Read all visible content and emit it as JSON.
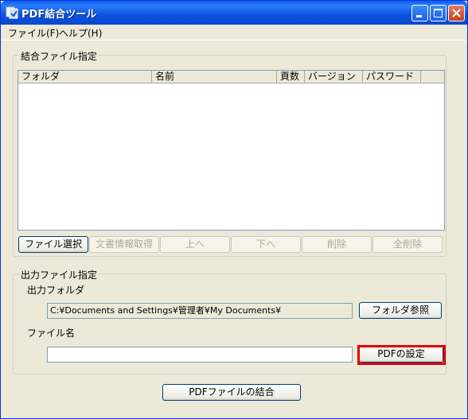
{
  "window": {
    "title": "PDF結合ツール",
    "icons": {
      "app": "pdf-app-icon",
      "minimize": "minimize-icon",
      "maximize": "maximize-icon",
      "close": "close-icon"
    }
  },
  "menu": {
    "items": [
      {
        "label": "ファイル(F)"
      },
      {
        "label": "ヘルプ(H)"
      }
    ]
  },
  "input_group": {
    "title": "結合ファイル指定",
    "columns": [
      "フォルダ",
      "名前",
      "頁数",
      "バージョン",
      "パスワード"
    ],
    "rows": [],
    "buttons": {
      "select_file": "ファイル選択",
      "get_doc_info": "文書情報取得",
      "move_up": "上へ",
      "move_down": "下へ",
      "delete": "削除",
      "delete_all": "全削除"
    }
  },
  "output_group": {
    "title": "出力ファイル指定",
    "folder_label": "出力フォルダ",
    "folder_value": "C:¥Documents and Settings¥管理者¥My Documents¥",
    "browse_button": "フォルダ参照",
    "filename_label": "ファイル名",
    "filename_value": "",
    "pdf_settings_button": "PDFの設定"
  },
  "merge_button": "PDFファイルの結合",
  "colors": {
    "titlebar": "#0a5fef",
    "face": "#ece9d8",
    "highlight": "#e00000"
  }
}
